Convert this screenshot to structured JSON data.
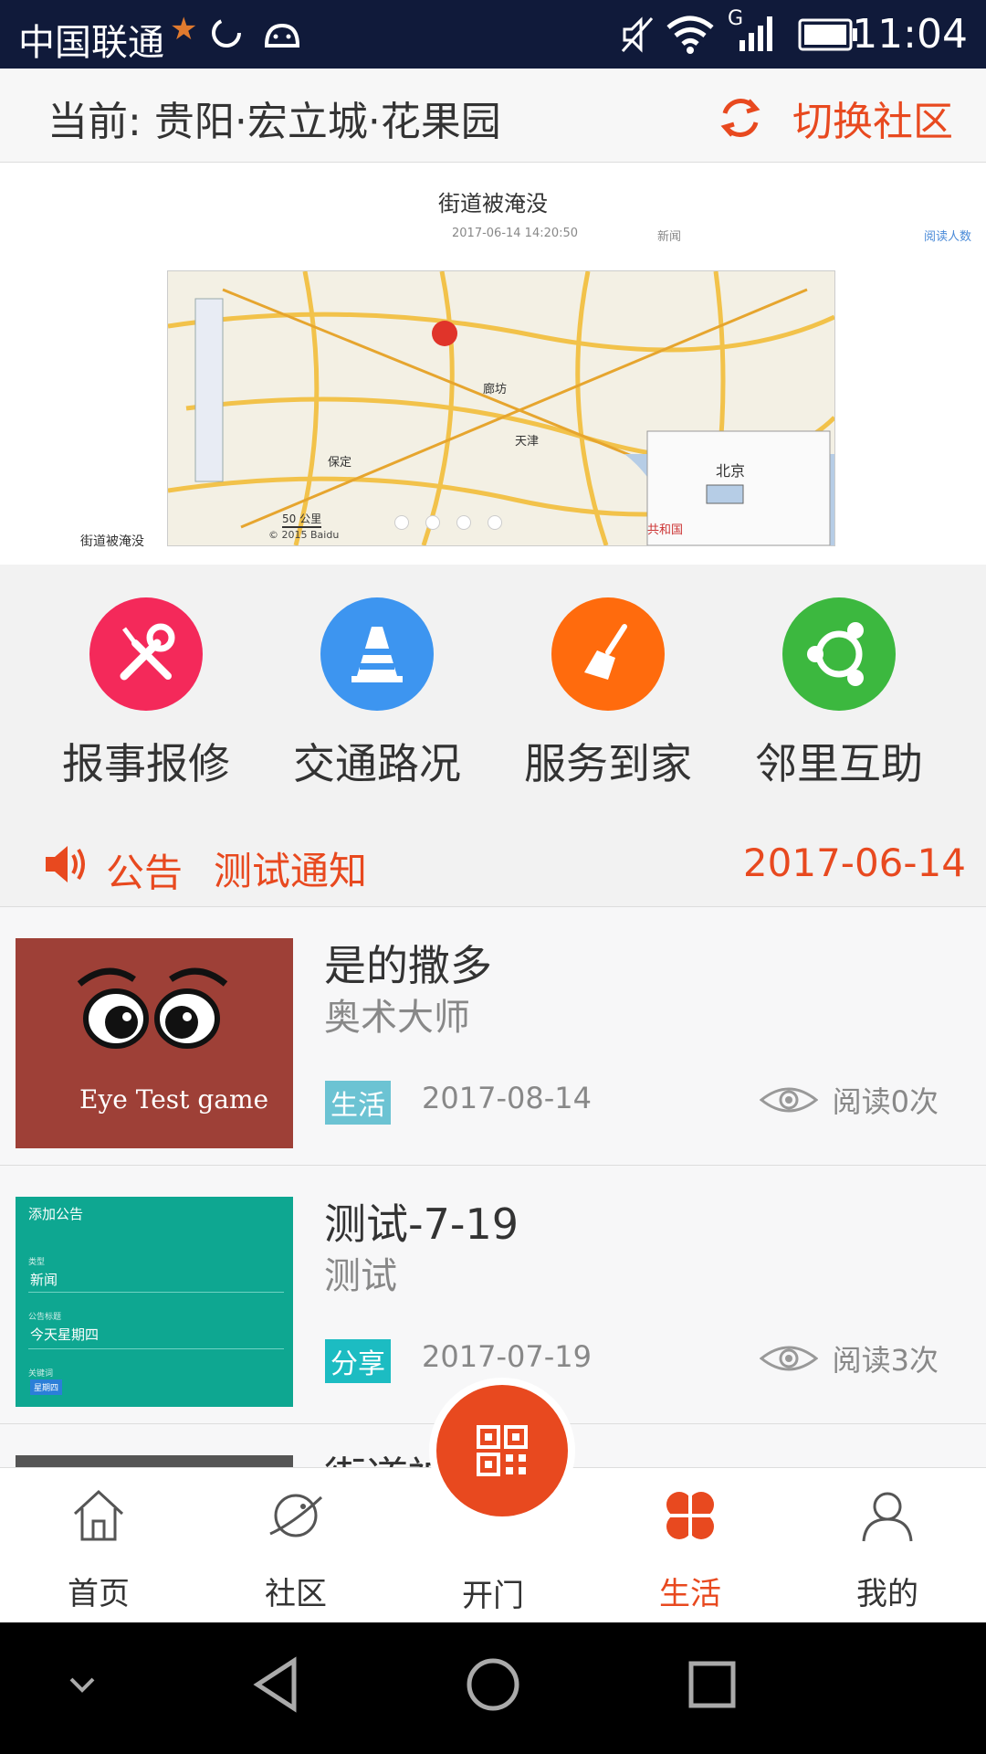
{
  "status_bar": {
    "carrier": "中国联通",
    "network": "G",
    "time": "11:04"
  },
  "community": {
    "current_label": "当前:",
    "current_value": "贵阳·宏立城·花果园",
    "switch_label": "切换社区"
  },
  "banner": {
    "title": "街道被淹没",
    "timestamp": "2017-06-14 14:20:50",
    "category": "新闻",
    "read_label": "阅读人数",
    "caption": "街道被淹没",
    "map_labels": [
      "北京",
      "天津",
      "保定",
      "廊坊",
      "50 公里",
      "© 2015 Baidu",
      "共和国"
    ]
  },
  "menu": [
    {
      "label": "报事报修",
      "icon": "wrench-screwdriver-icon",
      "color": "#f4295a"
    },
    {
      "label": "交通路况",
      "icon": "traffic-cone-icon",
      "color": "#3d95f0"
    },
    {
      "label": "服务到家",
      "icon": "broom-icon",
      "color": "#ff6b0d"
    },
    {
      "label": "邻里互助",
      "icon": "community-circle-icon",
      "color": "#3cb83f"
    }
  ],
  "notice": {
    "label": "公告",
    "text": "测试通知",
    "date": "2017-06-14"
  },
  "list": [
    {
      "title": "是的撒多",
      "subtitle": "奥术大师",
      "tag": "生活",
      "tag_color": "#6cc3d3",
      "date": "2017-08-14",
      "reads": "阅读0次",
      "thumb_text": "Eye Test game"
    },
    {
      "title": "测试-7-19",
      "subtitle": "测试",
      "tag": "分享",
      "tag_color": "#1cbcc2",
      "date": "2017-07-19",
      "reads": "阅读3次",
      "thumb_lines": [
        "添加公告",
        "类型",
        "新闻",
        "公告标题",
        "今天星期四",
        "关键词",
        "星期四"
      ]
    },
    {
      "title": "街道被"
    }
  ],
  "tabs": [
    {
      "label": "首页",
      "icon": "home-icon",
      "active": false
    },
    {
      "label": "社区",
      "icon": "planet-icon",
      "active": false
    },
    {
      "label": "开门",
      "icon": "qr-code-icon",
      "active": false
    },
    {
      "label": "生活",
      "icon": "clover-icon",
      "active": true
    },
    {
      "label": "我的",
      "icon": "user-icon",
      "active": false
    }
  ],
  "colors": {
    "accent": "#e8491f",
    "status_bar": "#101a3a"
  }
}
